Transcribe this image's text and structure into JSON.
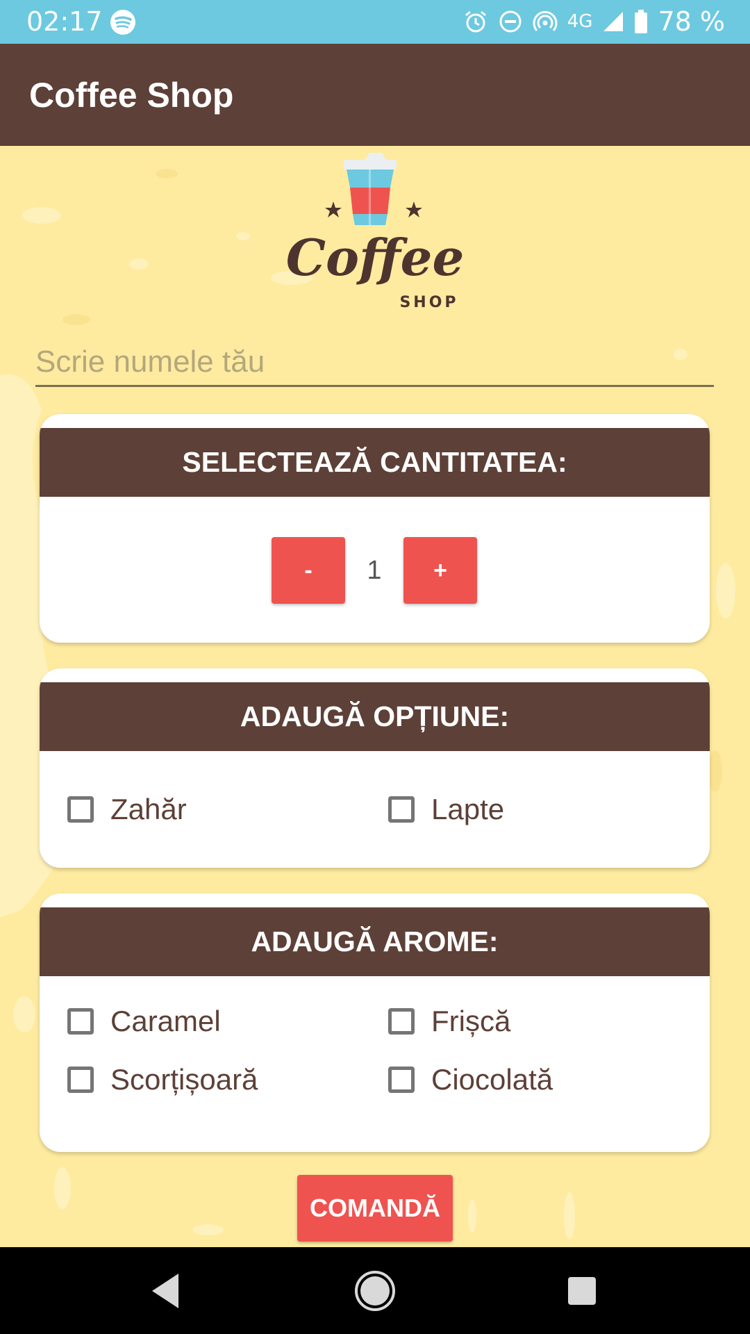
{
  "status_bar": {
    "time": "02:17",
    "network": "4G",
    "battery": "78 %",
    "icons": [
      "spotify-icon",
      "alarm-icon",
      "do-not-disturb-icon",
      "hotspot-icon",
      "signal-icon",
      "battery-icon"
    ]
  },
  "app_bar": {
    "title": "Coffee Shop"
  },
  "logo": {
    "word": "Coffee",
    "sub": "SHOP"
  },
  "name_input": {
    "placeholder": "Scrie numele tău",
    "value": ""
  },
  "quantity": {
    "header": "SELECTEAZĂ CANTITATEA:",
    "minus_label": "-",
    "plus_label": "+",
    "value": "1"
  },
  "options": {
    "header": "ADAUGĂ OPȚIUNE:",
    "items": [
      {
        "label": "Zahăr",
        "checked": false
      },
      {
        "label": "Lapte",
        "checked": false
      }
    ]
  },
  "aromas": {
    "header": "ADAUGĂ AROME:",
    "items": [
      {
        "label": "Caramel",
        "checked": false
      },
      {
        "label": "Frișcă",
        "checked": false
      },
      {
        "label": "Scorțișoară",
        "checked": false
      },
      {
        "label": "Ciocolată",
        "checked": false
      }
    ]
  },
  "order_button": {
    "label": "COMANDĂ"
  },
  "colors": {
    "status_bar": "#6CC9E0",
    "app_bar": "#5D4037",
    "background": "#FEEBA0",
    "accent": "#EF5350",
    "text_brown": "#5D4037"
  }
}
